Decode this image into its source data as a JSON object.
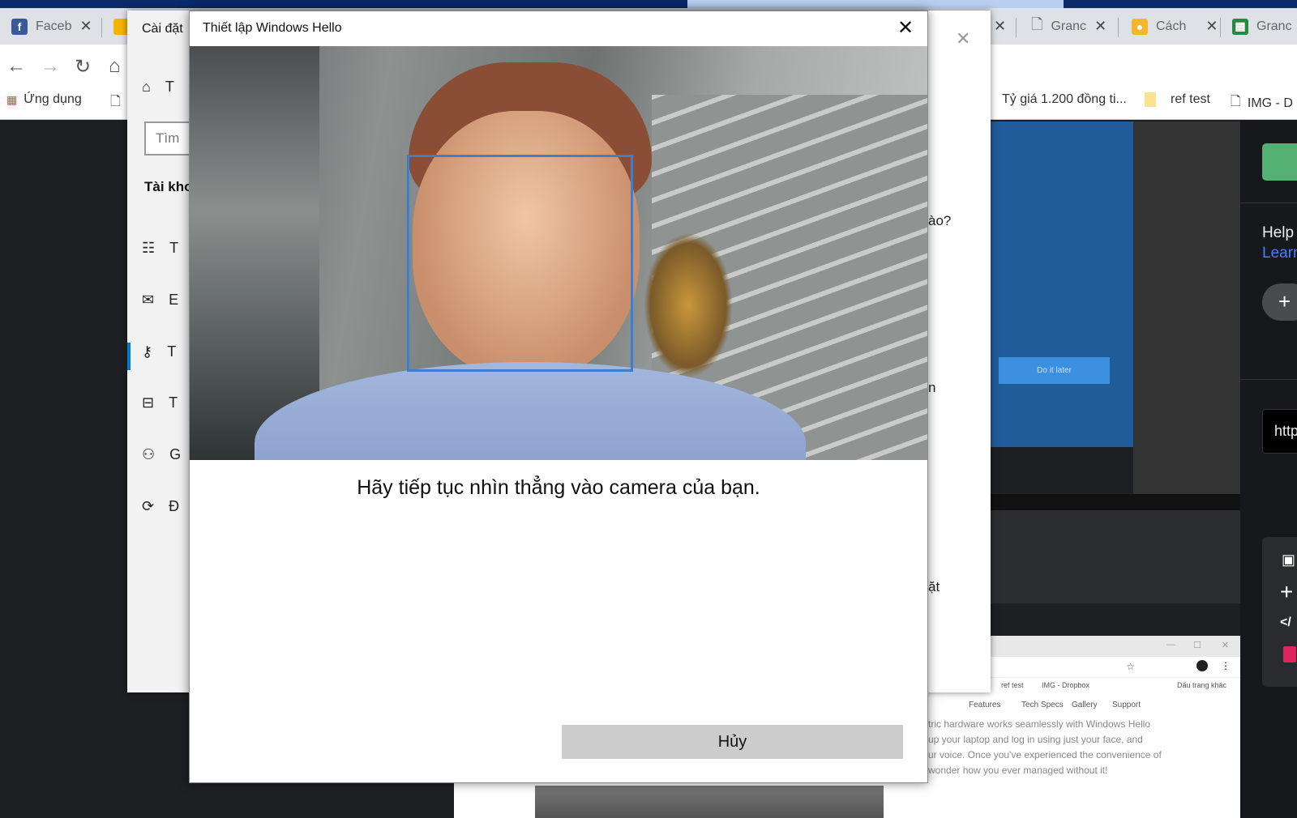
{
  "browser": {
    "tabs": [
      {
        "label": "Faceb",
        "icon": "facebook-icon"
      },
      {
        "label": "",
        "icon": "slides-icon"
      },
      {
        "label": "Granc",
        "icon": "document-icon"
      },
      {
        "label": "Cách",
        "icon": "keep-icon"
      },
      {
        "label": "Granc",
        "icon": "sheets-icon"
      }
    ],
    "bookmarks": [
      {
        "label": "Ứng dụng",
        "icon": "apps-icon"
      },
      {
        "label": "",
        "icon": "document-icon"
      },
      {
        "label": "Tỷ giá 1.200 đồng ti...",
        "icon": ""
      },
      {
        "label": "ref test",
        "icon": "folder-icon"
      },
      {
        "label": "IMG - D",
        "icon": "document-icon"
      }
    ]
  },
  "settings": {
    "title": "Cài đặt",
    "home": "T",
    "search_placeholder": "Tìm",
    "section": "Tài kho",
    "items": [
      {
        "label": "T",
        "icon": "user-info-icon"
      },
      {
        "label": "E",
        "icon": "email-icon"
      },
      {
        "label": "T",
        "icon": "key-icon",
        "active": true
      },
      {
        "label": "T",
        "icon": "briefcase-icon"
      },
      {
        "label": "G",
        "icon": "add-user-icon"
      },
      {
        "label": "Đ",
        "icon": "sync-icon"
      }
    ],
    "content_fragments": [
      "ào?",
      "n",
      "ặt"
    ]
  },
  "dialog": {
    "title": "Thiết lập Windows Hello",
    "instruction": "Hãy tiếp tục nhìn thẳng vào camera của bạn.",
    "cancel_label": "Hủy",
    "face_box_color": "#3b7fd4"
  },
  "background": {
    "do_later": "Do it later",
    "help": "Help",
    "learn": "Learn",
    "http": "http",
    "accent_blue": "#1f5c99",
    "green": "#55b074"
  },
  "bottom_window": {
    "bookmarks": [
      "ref test",
      "IMG - Dropbox",
      "Dấu trang khác"
    ],
    "nav": [
      "Features",
      "Tech Specs",
      "Gallery",
      "Support"
    ],
    "text": [
      "tric hardware works seamlessly with Windows Hello",
      "up your laptop and log in using just your face, and",
      "ur voice. Once you've experienced the convenience of",
      "wonder how you ever managed without it!"
    ]
  }
}
